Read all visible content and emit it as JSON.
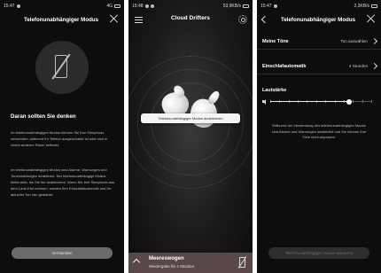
{
  "screen1": {
    "status": {
      "time": "15:47",
      "network": "4G",
      "battery": ""
    },
    "header": {
      "title": "Telefonunabhängiger Modus"
    },
    "icon": "phone-off-icon",
    "heading": "Daran sollten Sie denken",
    "paragraph1": "Im telefonunabhängigen Modus können Sie Ihre Sleepbuds verwenden, während Ihr Telefon ausgeschaltet ist oder sich in einem anderen Raum befindet.",
    "paragraph2": "Im telefonunabhängigen Modus sind Alarme, Warnungen und Toneinstellungen deaktiviert. Der telefonunabhängige Modus bleibt aktiv, bis Sie ihn deaktivieren. Wenn Sie Ihre Sleepbuds aus dem Lade-Etui nehmen, werden Ihre Einschlafautomatik und Ihr aktueller Ton neu gestartet.",
    "button": "Verstanden"
  },
  "screen2": {
    "status": {
      "time": "15:48",
      "speed": "53,9KB/s",
      "battery": ""
    },
    "header": {
      "title": "Cloud Drifters"
    },
    "tooltip": "Telefonunabhängiger Modus deaktivieren",
    "now_playing": {
      "title": "Meereswogen",
      "subtitle": "Wiedergabe für 4 Stunden"
    },
    "colors": {
      "bottom_bar": "#5a4748"
    }
  },
  "screen3": {
    "status": {
      "time": "15:47",
      "speed": "2,3KB/s",
      "battery": ""
    },
    "header": {
      "title": "Telefonunabhängiger Modus"
    },
    "rows": [
      {
        "label": "Meine Töne",
        "value": "Ton auswählen"
      },
      {
        "label": "Einschlafautomatik",
        "value": "4 Stunden"
      }
    ],
    "volume": {
      "label": "Lautstärke",
      "level_fraction": 0.77
    },
    "note": "Während der Verwendung des telefonunabhängigen Modus sind Alarme und Warnungen deaktiviert und Sie können Ihre Töne nicht anpassen.",
    "button": "Telefonunabhängigen Modus aktivieren"
  }
}
